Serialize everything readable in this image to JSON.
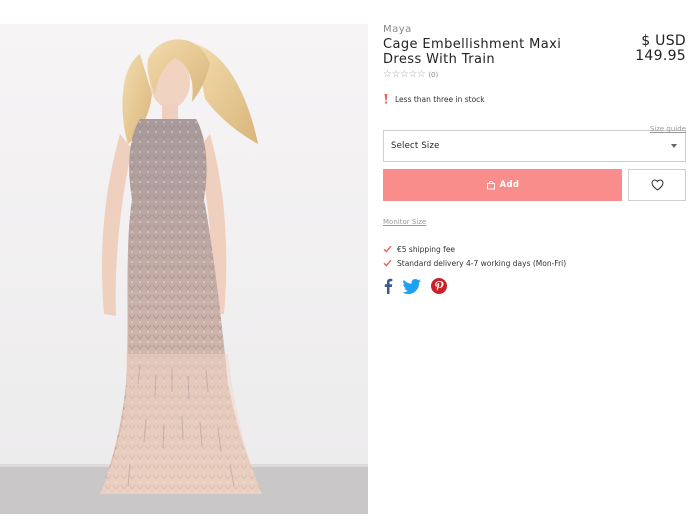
{
  "product": {
    "brand": "Maya",
    "title": "Cage Embellishment Maxi Dress With Train",
    "currency": "$ USD",
    "price": "149.95",
    "rating_stars": "☆☆☆☆☆",
    "rating_count": "(0)"
  },
  "stock": {
    "text": "Less than three in stock"
  },
  "size": {
    "guide_label": "Size guide",
    "select_label": "Select Size"
  },
  "actions": {
    "add_label": "Add",
    "monitor_label": "Monitor Size"
  },
  "benefits": [
    {
      "text": "€5 shipping fee"
    },
    {
      "text": "Standard delivery 4-7 working days (Mon-Fri)"
    }
  ],
  "share": {
    "icons": [
      "facebook-icon",
      "twitter-icon",
      "pinterest-icon"
    ]
  },
  "colors": {
    "add_button": "#f88d8b",
    "check": "#e8615f",
    "facebook": "#3b5998",
    "twitter": "#1da1f2",
    "pinterest": "#cb2027"
  }
}
